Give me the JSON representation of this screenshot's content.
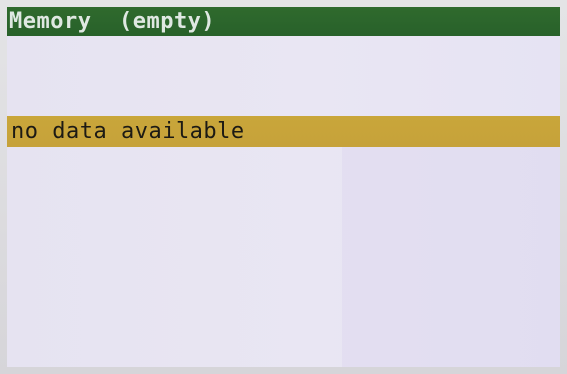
{
  "header": {
    "title": "Memory  (empty)"
  },
  "list": {
    "items": [
      {
        "label": "no data available",
        "selected": true
      }
    ]
  },
  "colors": {
    "title_bar": "#2c662c",
    "title_text": "#dfe8e2",
    "selection": "#c8a43a",
    "screen_background": "#e7e4f2",
    "item_text": "#1c1a14"
  }
}
